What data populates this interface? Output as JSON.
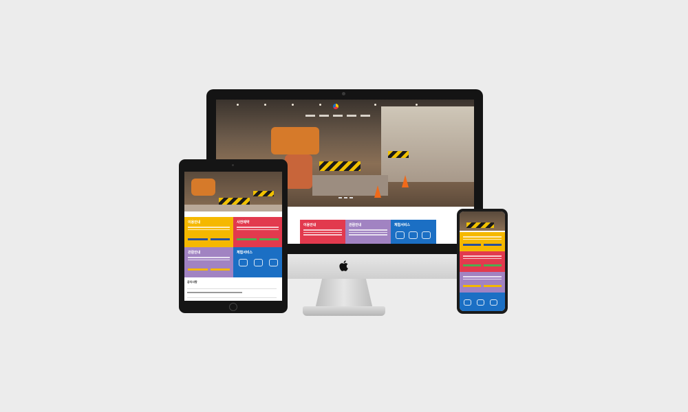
{
  "showcase": {
    "background": "#ececec",
    "colors": {
      "yellow": "#f5b800",
      "red": "#e23a4e",
      "purple": "#a183c2",
      "blue": "#1b6fc4",
      "green": "#4caf50",
      "dark_blue": "#2a4f9a"
    },
    "desktop": {
      "device": "imac",
      "brand_icon": "apple-logo-icon",
      "tiles": [
        {
          "label": "이용안내"
        },
        {
          "label": "관람안내"
        },
        {
          "label": "체험서비스"
        }
      ]
    },
    "tablet": {
      "device": "ipad",
      "tiles": [
        {
          "label": "이용안내"
        },
        {
          "label": "사전예약"
        },
        {
          "label": "관람안내"
        },
        {
          "label": "체험서비스"
        }
      ],
      "section_title": "공지사항"
    },
    "phone": {
      "device": "iphone"
    }
  }
}
